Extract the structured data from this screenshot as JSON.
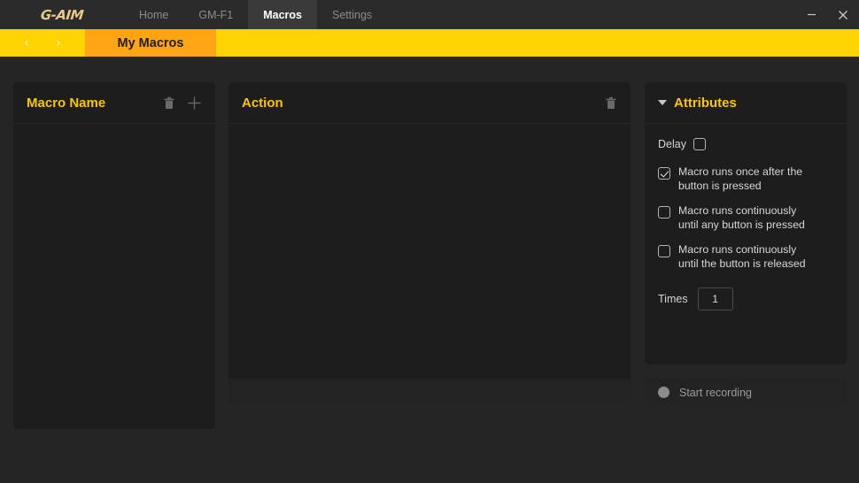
{
  "window": {
    "brand": "G-AIM",
    "minimize_label": "minimize",
    "close_label": "close"
  },
  "nav": {
    "tabs": [
      {
        "label": "Home",
        "active": false
      },
      {
        "label": "GM-F1",
        "active": false
      },
      {
        "label": "Macros",
        "active": true
      },
      {
        "label": "Settings",
        "active": false
      }
    ]
  },
  "subnav": {
    "prev_arrow": "‹",
    "next_arrow": "›",
    "current_tab": "My Macros"
  },
  "panels": {
    "macro_name": {
      "title": "Macro Name",
      "delete_icon": "trash-icon",
      "add_icon": "plus-icon",
      "items": []
    },
    "action": {
      "title": "Action",
      "delete_icon": "trash-icon",
      "items": []
    },
    "attributes": {
      "title": "Attributes",
      "collapse_icon": "caret-down-icon",
      "delay": {
        "label": "Delay",
        "checked": false
      },
      "options": [
        {
          "label": "Macro runs once after the button is pressed",
          "checked": true
        },
        {
          "label": "Macro runs continuously until any button is pressed",
          "checked": false
        },
        {
          "label": "Macro runs continuously until the button is released",
          "checked": false
        }
      ],
      "times": {
        "label": "Times",
        "value": "1"
      }
    }
  },
  "record": {
    "label": "Start recording",
    "indicator": "record-dot-icon"
  },
  "colors": {
    "accent_yellow": "#ffd400",
    "accent_orange": "#ffa413",
    "title_gold": "#ffc400",
    "panel_bg": "#1d1d1d",
    "app_bg": "#252525",
    "titlebar_bg": "#2b2b2b"
  }
}
